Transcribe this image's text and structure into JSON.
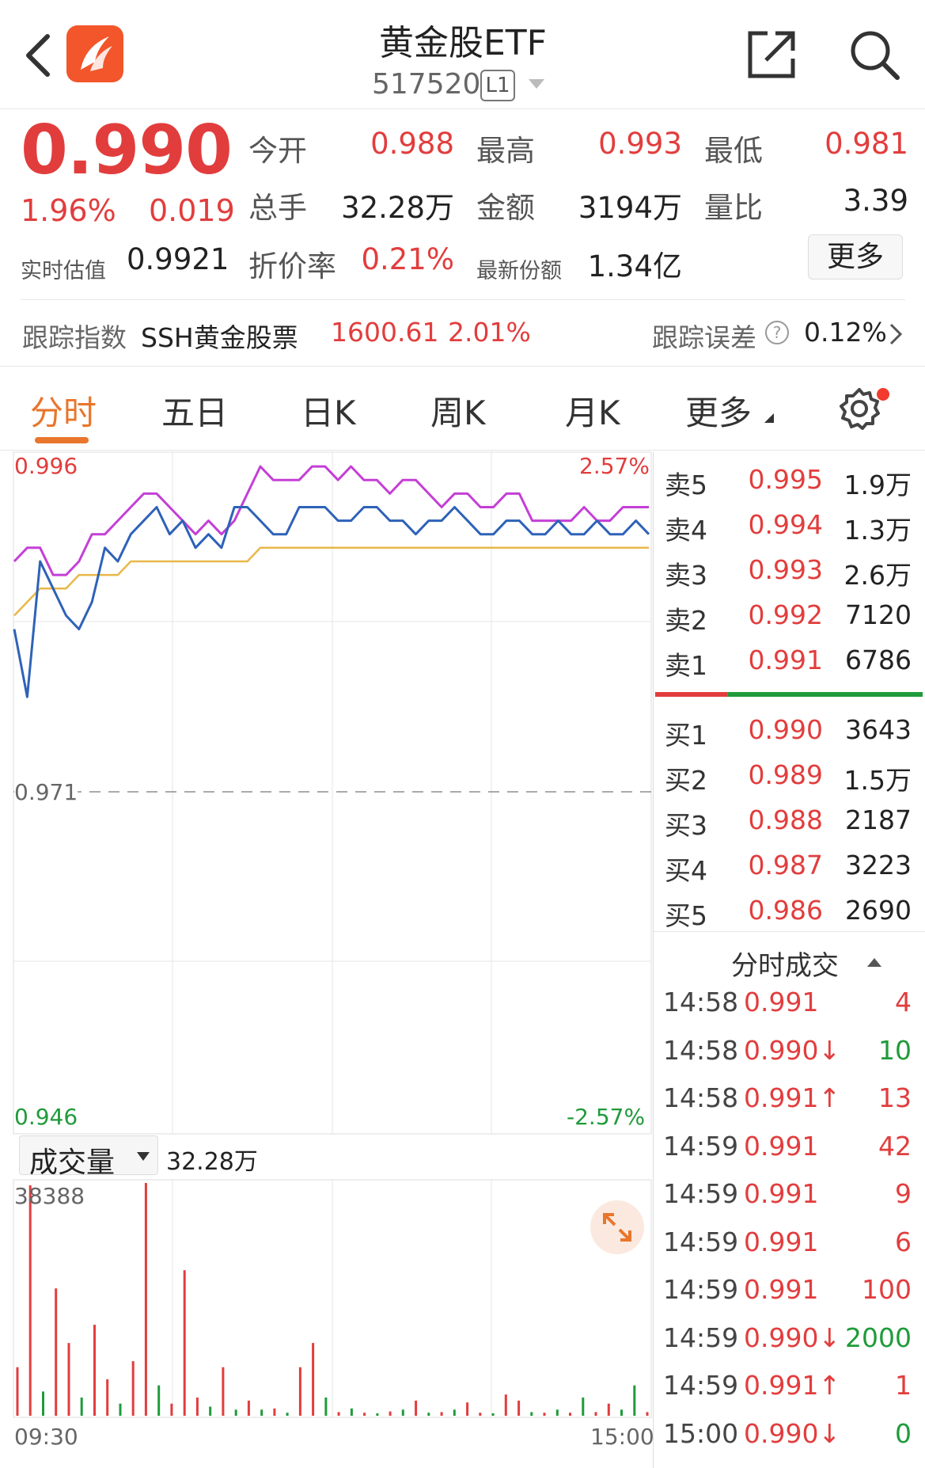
{
  "header": {
    "title": "黄金股ETF",
    "code": "517520",
    "level_badge": "L1",
    "icons": [
      "back-arrow-icon",
      "app-logo-icon",
      "share-icon",
      "search-icon"
    ]
  },
  "quote": {
    "price": "0.990",
    "change_pct": "1.96%",
    "change": "0.019",
    "open_label": "今开",
    "open": "0.988",
    "high_label": "最高",
    "high": "0.993",
    "low_label": "最低",
    "low": "0.981",
    "volume_label": "总手",
    "volume": "32.28万",
    "amount_label": "金额",
    "amount": "3194万",
    "ratio_label": "量比",
    "ratio": "3.39",
    "iopv_label": "实时估值",
    "iopv": "0.9921",
    "discount_label": "折价率",
    "discount": "0.21%",
    "shares_label": "最新份额",
    "shares": "1.34亿",
    "more_button": "更多"
  },
  "tracking": {
    "index_label": "跟踪指数",
    "index_name": "SSH黄金股票",
    "index_value": "1600.61",
    "index_pct": "2.01%",
    "error_label": "跟踪误差",
    "error_value": "0.12%"
  },
  "tabs": [
    "分时",
    "五日",
    "日K",
    "周K",
    "月K",
    "更多"
  ],
  "colors": {
    "up": "#e23d3d",
    "down": "#1f9b3a",
    "accent": "#e8762c",
    "price_line": "#2e62b8",
    "index_line": "#c43fd6",
    "avg_line": "#e8b84a"
  },
  "chart_data": {
    "type": "line",
    "y_top_label": "0.996",
    "y_mid_label": "0.971",
    "y_bottom_label": "0.946",
    "pct_top_label": "2.57%",
    "pct_bottom_label": "-2.57%",
    "ylim": [
      0.946,
      0.996
    ],
    "x_start_label": "09:30",
    "x_end_label": "15:00",
    "series": [
      {
        "key": "price",
        "values": [
          0.983,
          0.978,
          0.988,
          0.986,
          0.984,
          0.983,
          0.985,
          0.989,
          0.988,
          0.99,
          0.991,
          0.992,
          0.99,
          0.991,
          0.989,
          0.99,
          0.989,
          0.992,
          0.992,
          0.991,
          0.99,
          0.99,
          0.992,
          0.992,
          0.992,
          0.991,
          0.991,
          0.992,
          0.992,
          0.991,
          0.991,
          0.99,
          0.991,
          0.991,
          0.992,
          0.991,
          0.99,
          0.99,
          0.991,
          0.991,
          0.99,
          0.99,
          0.991,
          0.99,
          0.99,
          0.991,
          0.99,
          0.99,
          0.991,
          0.99
        ]
      },
      {
        "key": "index",
        "values": [
          0.988,
          0.989,
          0.989,
          0.987,
          0.987,
          0.988,
          0.99,
          0.99,
          0.991,
          0.992,
          0.993,
          0.993,
          0.992,
          0.991,
          0.99,
          0.991,
          0.99,
          0.991,
          0.993,
          0.995,
          0.994,
          0.994,
          0.994,
          0.995,
          0.995,
          0.994,
          0.995,
          0.994,
          0.994,
          0.993,
          0.994,
          0.994,
          0.993,
          0.992,
          0.993,
          0.993,
          0.992,
          0.992,
          0.993,
          0.993,
          0.991,
          0.991,
          0.991,
          0.991,
          0.992,
          0.991,
          0.991,
          0.992,
          0.992,
          0.992
        ]
      },
      {
        "key": "average",
        "values": [
          0.984,
          0.985,
          0.986,
          0.986,
          0.986,
          0.987,
          0.987,
          0.987,
          0.987,
          0.988,
          0.988,
          0.988,
          0.988,
          0.988,
          0.988,
          0.988,
          0.988,
          0.988,
          0.988,
          0.989,
          0.989,
          0.989,
          0.989,
          0.989,
          0.989,
          0.989,
          0.989,
          0.989,
          0.989,
          0.989,
          0.989,
          0.989,
          0.989,
          0.989,
          0.989,
          0.989,
          0.989,
          0.989,
          0.989,
          0.989,
          0.989,
          0.989,
          0.989,
          0.989,
          0.989,
          0.989,
          0.989,
          0.989,
          0.989,
          0.989
        ]
      }
    ]
  },
  "volume_panel": {
    "selector_label": "成交量",
    "total": "32.28万",
    "max_label": "38388",
    "ylim": [
      0,
      38388
    ],
    "bars": [
      {
        "v": 8000,
        "up": true
      },
      {
        "v": 38000,
        "up": true
      },
      {
        "v": 4000,
        "up": false
      },
      {
        "v": 21000,
        "up": true
      },
      {
        "v": 12000,
        "up": true
      },
      {
        "v": 3000,
        "up": false
      },
      {
        "v": 15000,
        "up": true
      },
      {
        "v": 6000,
        "up": true
      },
      {
        "v": 2000,
        "up": false
      },
      {
        "v": 9000,
        "up": true
      },
      {
        "v": 38388,
        "up": true
      },
      {
        "v": 5000,
        "up": false
      },
      {
        "v": 2000,
        "up": true
      },
      {
        "v": 24000,
        "up": true
      },
      {
        "v": 3000,
        "up": true
      },
      {
        "v": 1500,
        "up": false
      },
      {
        "v": 8000,
        "up": true
      },
      {
        "v": 1000,
        "up": false
      },
      {
        "v": 2500,
        "up": true
      },
      {
        "v": 1000,
        "up": false
      },
      {
        "v": 1200,
        "up": true
      },
      {
        "v": 500,
        "up": false
      },
      {
        "v": 8000,
        "up": true
      },
      {
        "v": 12000,
        "up": true
      },
      {
        "v": 3000,
        "up": false
      },
      {
        "v": 600,
        "up": true
      },
      {
        "v": 1200,
        "up": false
      },
      {
        "v": 500,
        "up": true
      },
      {
        "v": 400,
        "up": false
      },
      {
        "v": 700,
        "up": true
      },
      {
        "v": 1000,
        "up": false
      },
      {
        "v": 2500,
        "up": true
      },
      {
        "v": 500,
        "up": false
      },
      {
        "v": 600,
        "up": true
      },
      {
        "v": 1000,
        "up": false
      },
      {
        "v": 2200,
        "up": true
      },
      {
        "v": 500,
        "up": true
      },
      {
        "v": 400,
        "up": false
      },
      {
        "v": 3500,
        "up": true
      },
      {
        "v": 2500,
        "up": true
      },
      {
        "v": 600,
        "up": false
      },
      {
        "v": 500,
        "up": true
      },
      {
        "v": 1000,
        "up": false
      },
      {
        "v": 500,
        "up": true
      },
      {
        "v": 3000,
        "up": false
      },
      {
        "v": 600,
        "up": true
      },
      {
        "v": 2000,
        "up": true
      },
      {
        "v": 1000,
        "up": false
      },
      {
        "v": 5000,
        "up": false
      },
      {
        "v": 600,
        "up": true
      }
    ]
  },
  "order_book": {
    "asks": [
      {
        "label": "卖5",
        "price": "0.995",
        "vol": "1.9万"
      },
      {
        "label": "卖4",
        "price": "0.994",
        "vol": "1.3万"
      },
      {
        "label": "卖3",
        "price": "0.993",
        "vol": "2.6万"
      },
      {
        "label": "卖2",
        "price": "0.992",
        "vol": "7120"
      },
      {
        "label": "卖1",
        "price": "0.991",
        "vol": "6786"
      }
    ],
    "bids": [
      {
        "label": "买1",
        "price": "0.990",
        "vol": "3643"
      },
      {
        "label": "买2",
        "price": "0.989",
        "vol": "1.5万"
      },
      {
        "label": "买3",
        "price": "0.988",
        "vol": "2187"
      },
      {
        "label": "买4",
        "price": "0.987",
        "vol": "3223"
      },
      {
        "label": "买5",
        "price": "0.986",
        "vol": "2690"
      }
    ],
    "ask_ratio": 0.27
  },
  "trades": {
    "title": "分时成交",
    "rows": [
      {
        "time": "14:58",
        "price": "0.991",
        "vol": "4",
        "dir": "up"
      },
      {
        "time": "14:58",
        "price": "0.990↓",
        "vol": "10",
        "dir": "down"
      },
      {
        "time": "14:58",
        "price": "0.991↑",
        "vol": "13",
        "dir": "up"
      },
      {
        "time": "14:59",
        "price": "0.991",
        "vol": "42",
        "dir": "up"
      },
      {
        "time": "14:59",
        "price": "0.991",
        "vol": "9",
        "dir": "up"
      },
      {
        "time": "14:59",
        "price": "0.991",
        "vol": "6",
        "dir": "up"
      },
      {
        "time": "14:59",
        "price": "0.991",
        "vol": "100",
        "dir": "up"
      },
      {
        "time": "14:59",
        "price": "0.990↓",
        "vol": "2000",
        "dir": "down"
      },
      {
        "time": "14:59",
        "price": "0.991↑",
        "vol": "1",
        "dir": "up"
      },
      {
        "time": "15:00",
        "price": "0.990↓",
        "vol": "0",
        "dir": "down"
      }
    ]
  }
}
